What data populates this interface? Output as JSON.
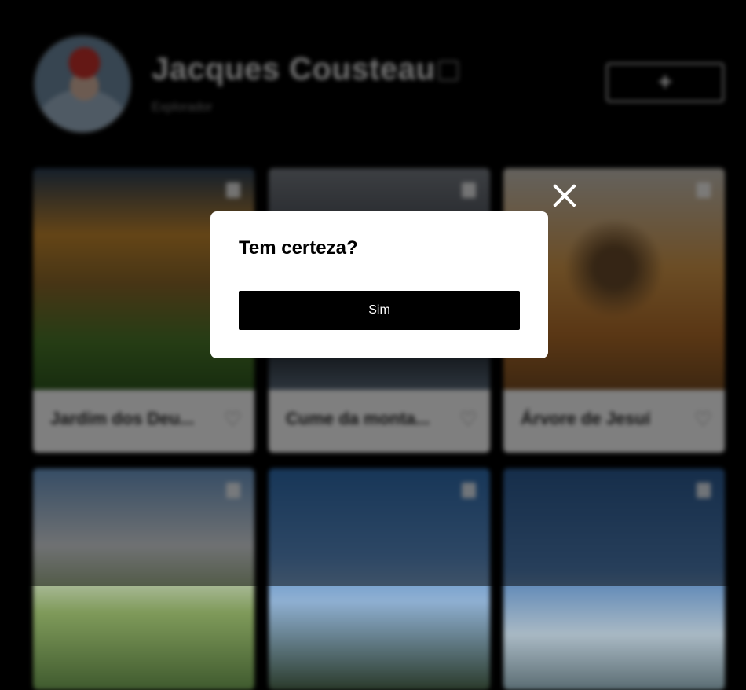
{
  "profile": {
    "name": "Jacques Cousteau",
    "subtitle": "Explorador",
    "add_label": "+"
  },
  "cards": [
    {
      "title": "Jardim dos Deu...",
      "heart": "♡"
    },
    {
      "title": "Cume da monta...",
      "heart": "♡"
    },
    {
      "title": "Árvore de Jesuí",
      "heart": "♡"
    },
    {
      "title": "",
      "heart": ""
    },
    {
      "title": "",
      "heart": ""
    },
    {
      "title": "",
      "heart": ""
    }
  ],
  "dialog": {
    "title": "Tem certeza?",
    "confirm_label": "Sim",
    "close_icon": "close-icon"
  }
}
